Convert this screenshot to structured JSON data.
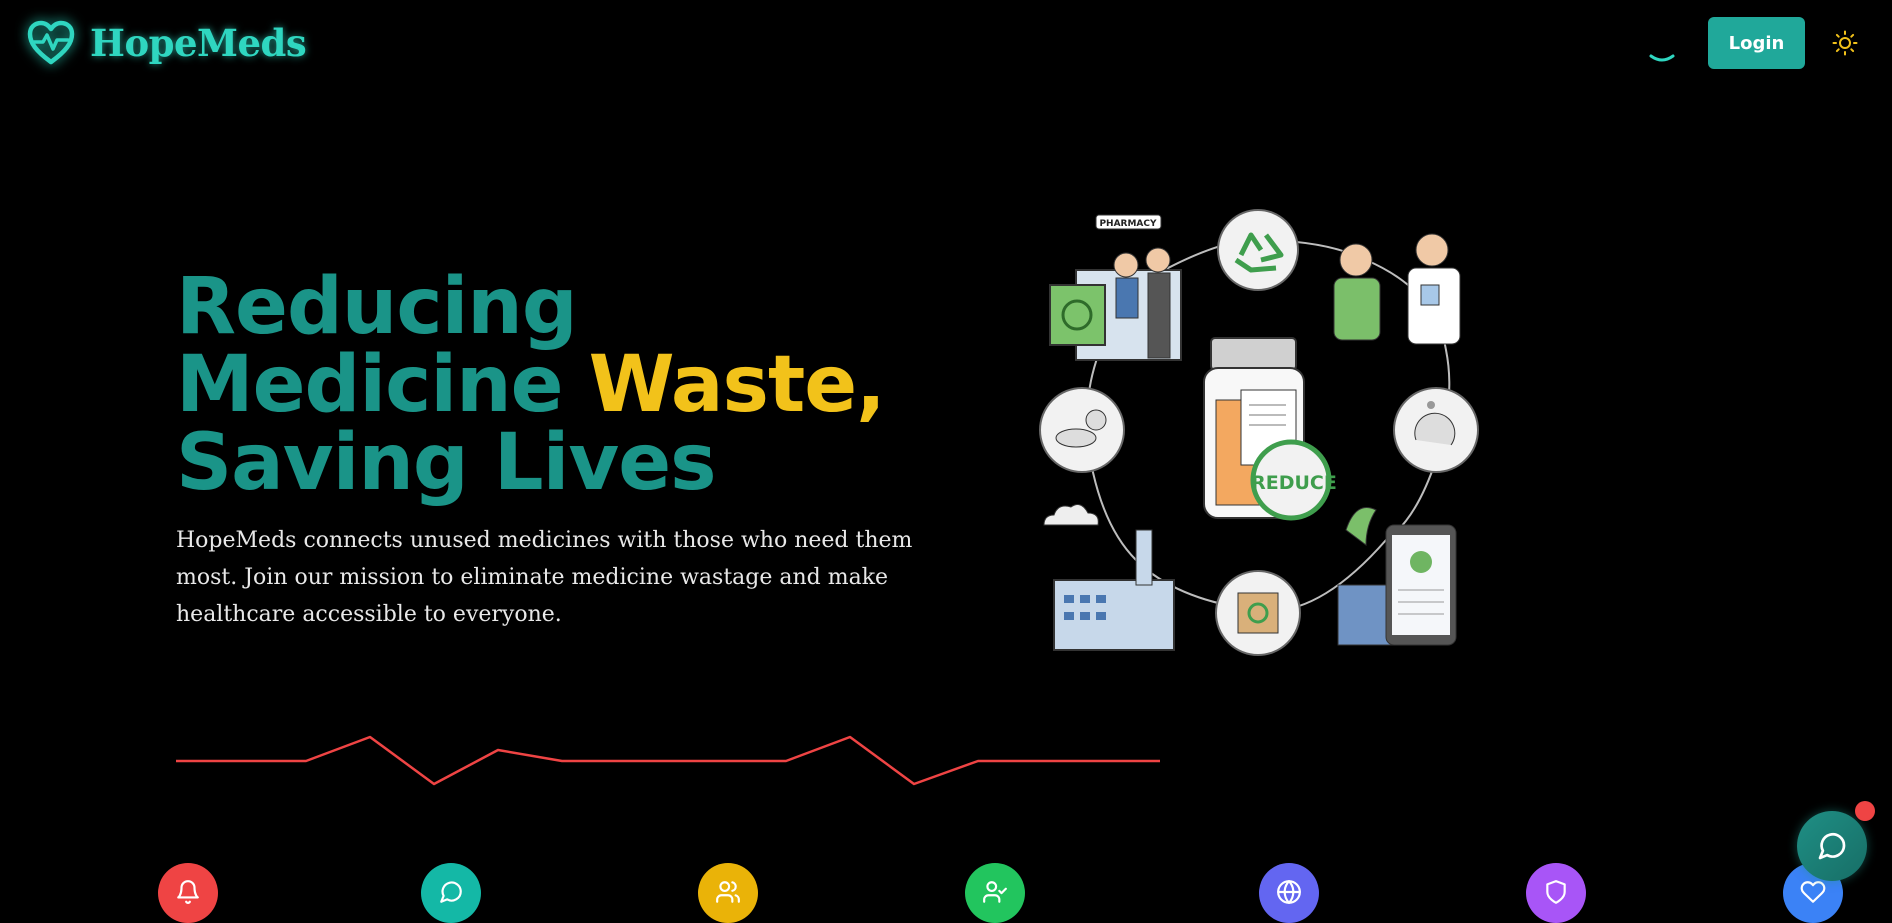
{
  "header": {
    "brand": "HopeMeds",
    "login_label": "Login"
  },
  "hero": {
    "title_line1": "Reducing",
    "title_line2a": "Medicine ",
    "title_line2b": "Waste,",
    "title_line3": "Saving Lives",
    "subtitle": "HopeMeds connects unused medicines with those who need them most. Join our mission to eliminate medicine wastage and make healthcare accessible to everyone.",
    "illustration_badge": "REDUCE",
    "illustration_pharmacy_sign": "PHARMACY"
  },
  "feature_icons": [
    {
      "icon": "bell-icon",
      "color": "#ef4444"
    },
    {
      "icon": "message-icon",
      "color": "#14b8a6"
    },
    {
      "icon": "users-icon",
      "color": "#eab308"
    },
    {
      "icon": "user-check-icon",
      "color": "#22c55e"
    },
    {
      "icon": "globe-icon",
      "color": "#6366f1"
    },
    {
      "icon": "shield-icon",
      "color": "#a855f7"
    },
    {
      "icon": "heart-icon",
      "color": "#3b82f6"
    }
  ],
  "colors": {
    "brand_teal": "#2fd6c0",
    "title_teal": "#1a9488",
    "accent_yellow": "#f2c21a",
    "pulse_red": "#ef4444"
  }
}
